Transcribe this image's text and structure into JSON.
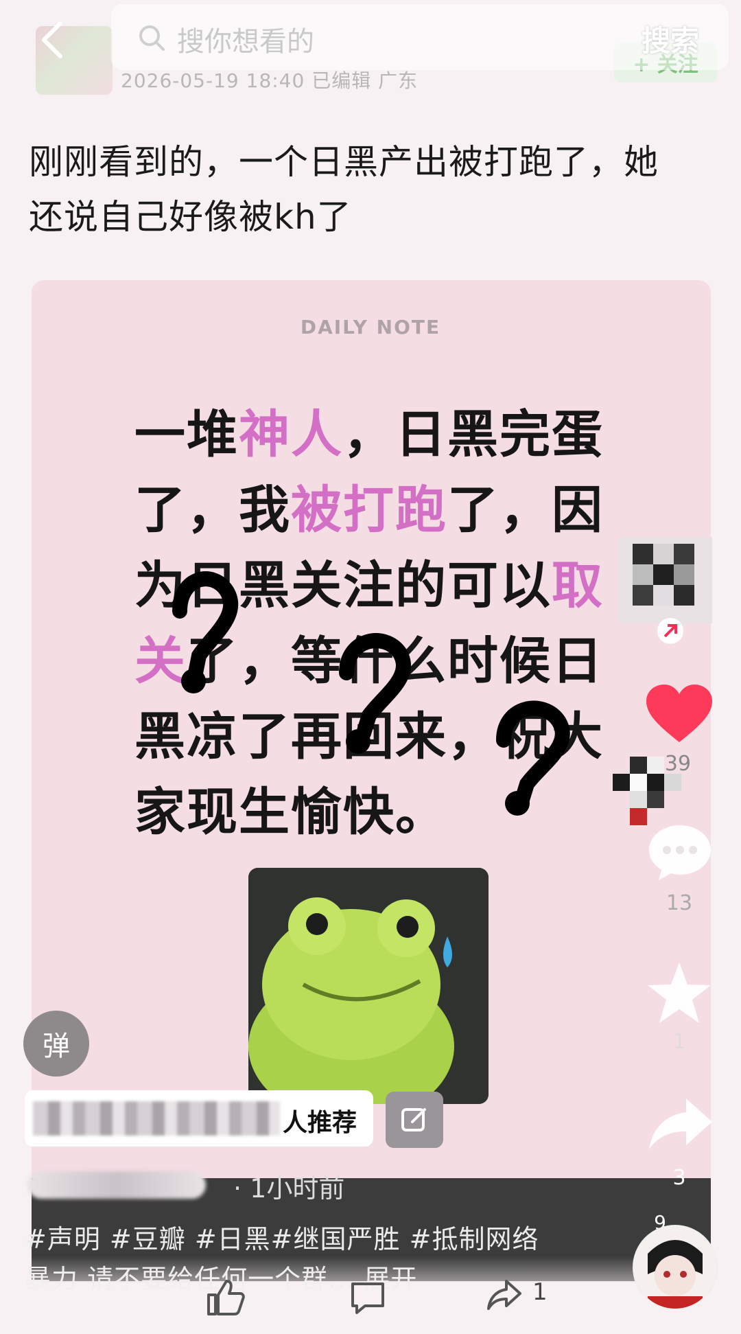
{
  "header": {
    "post_date": "2026-05-19 18:40 已编辑 广东",
    "follow_label": "+ 关注"
  },
  "search": {
    "placeholder": "搜你想看的",
    "button_label": "搜索"
  },
  "post": {
    "title": "刚刚看到的，一个日黑产出被打跑了，她还说自己好像被kh了"
  },
  "image_card": {
    "label": "DAILY NOTE",
    "note_lines": [
      [
        {
          "t": "一堆"
        },
        {
          "t": "神人",
          "hl": true
        },
        {
          "t": "，日黑完蛋"
        }
      ],
      [
        {
          "t": "了，我"
        },
        {
          "t": "被打跑",
          "hl": true
        },
        {
          "t": "了，因"
        }
      ],
      [
        {
          "t": "为日黑关注的可以"
        },
        {
          "t": "取",
          "hl": true
        }
      ],
      [
        {
          "t": "关",
          "hl": true
        },
        {
          "t": "了，等什么时候日"
        }
      ],
      [
        {
          "t": "黑凉了再回来，祝大"
        }
      ],
      [
        {
          "t": "家现生愉快。"
        }
      ]
    ]
  },
  "actions": {
    "like_count": "39",
    "comment_count": "13",
    "star_count": "1",
    "share_count": "3",
    "small_count": "9"
  },
  "bottom": {
    "danmaku_label": "弹",
    "recommend_text": "人推荐",
    "time_ago": "· 1小时前",
    "caption": "#声明 #豆瓣 #日黑#继国严胜 #抵制网络暴力 请不要给任何一个群... ",
    "expand_label": "展开",
    "share_mini_count": "1"
  },
  "colors": {
    "highlight": "#d36fc4",
    "heart": "#fe3a5a",
    "card_bg": "#f5dde4"
  }
}
